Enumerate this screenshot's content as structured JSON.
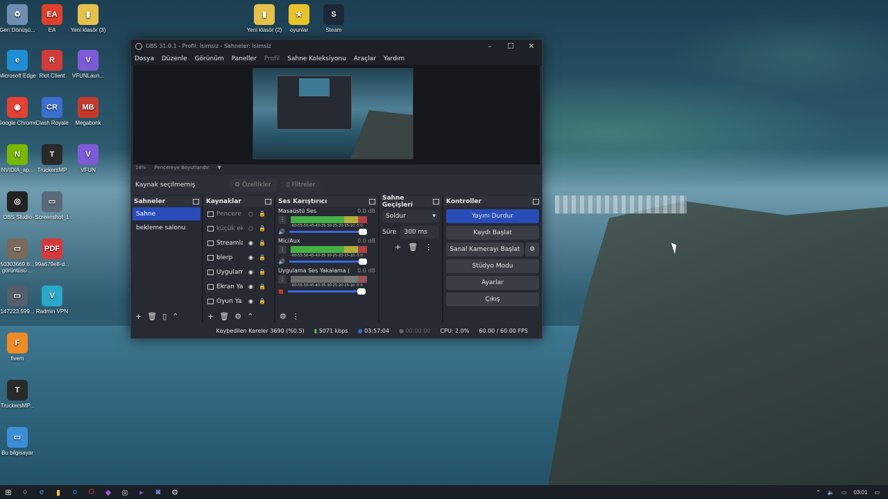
{
  "desktop": {
    "icons": [
      {
        "label": "Geri Dönüşü...",
        "color": "#6f8fb0",
        "glyph": "♻"
      },
      {
        "label": "EA",
        "color": "#e0402a",
        "glyph": "EA"
      },
      {
        "label": "Yeni klasör (3)",
        "color": "#e5c14b",
        "glyph": "▮"
      },
      {
        "label": "Microsoft Edge",
        "color": "#1e8fd6",
        "glyph": "e"
      },
      {
        "label": "Riot Client",
        "color": "#d43b3b",
        "glyph": "R"
      },
      {
        "label": "VFUNLaun...",
        "color": "#7d5bd6",
        "glyph": "V"
      },
      {
        "label": "Google Chrome",
        "color": "#e44134",
        "glyph": "◉"
      },
      {
        "label": "Clash Royale",
        "color": "#3b6fd1",
        "glyph": "CR"
      },
      {
        "label": "Megabonk",
        "color": "#c5392a",
        "glyph": "MB"
      },
      {
        "label": "NVIDIA_ap...",
        "color": "#76b900",
        "glyph": "N"
      },
      {
        "label": "TruckersMP",
        "color": "#2a2a2a",
        "glyph": "T"
      },
      {
        "label": "VFUN",
        "color": "#7d5bd6",
        "glyph": "V"
      },
      {
        "label": "OBS Studio",
        "color": "#222",
        "glyph": "◎"
      },
      {
        "label": "Screenshot_1",
        "color": "#5a6a7a",
        "glyph": "▭"
      },
      {
        "label": "50303669.6... görüntüsü ...",
        "color": "#7a6a5a",
        "glyph": "▭"
      },
      {
        "label": "99a679e8-d...",
        "color": "#d63a3a",
        "glyph": "PDF"
      },
      {
        "label": "147223.599...",
        "color": "#555e6a",
        "glyph": "▭"
      },
      {
        "label": "Radmin VPN",
        "color": "#2aa8c9",
        "glyph": "V"
      },
      {
        "label": "fivem",
        "color": "#f08a24",
        "glyph": "F"
      },
      {
        "label": "TruckersMP...",
        "color": "#2a2a2a",
        "glyph": "T"
      },
      {
        "label": "Bu bilgisayar",
        "color": "#3a8fd6",
        "glyph": "▭"
      },
      {
        "label": "Yeni klasör (2)",
        "color": "#e5c14b",
        "glyph": "▮"
      },
      {
        "label": "oyunlar",
        "color": "#e8c32a",
        "glyph": "★"
      },
      {
        "label": "Steam",
        "color": "#1b2838",
        "glyph": "S"
      }
    ]
  },
  "obs": {
    "title": "OBS 31.0.1 - Profil: İsimsiz - Sahneler: İsimsiz",
    "menu": [
      "Dosya",
      "Düzenle",
      "Görünüm",
      "Paneller",
      "Profil",
      "Sahne Koleksiyonu",
      "Araçlar",
      "Yardım"
    ],
    "zoom": "18%",
    "zoom_mode": "Pencereye Boyutlandır",
    "source_status": "Kaynak seçilmemiş",
    "properties_btn": "Özellikler",
    "filters_btn": "Filtreler",
    "scenes": {
      "title": "Sahneler",
      "items": [
        "Sahne",
        "bekleme salonu"
      ]
    },
    "sources": {
      "title": "Kaynaklar",
      "items": [
        "Pencere",
        "küçük ek",
        "Streamla",
        "blerp",
        "Uygulam",
        "Ekran Ya",
        "Oyun Ya"
      ]
    },
    "mixer": {
      "title": "Ses Karıştırıcı",
      "channels": [
        {
          "name": "Masaüstü Ses",
          "db": "0.0 dB"
        },
        {
          "name": "Mic/Aux",
          "db": "0.0 dB"
        },
        {
          "name": "Uygulama Ses Yakalama (B",
          "db": "0.0 dB"
        }
      ],
      "ticks": "-60-55-50-45-40-35-30-25-20-15-10 -5  0"
    },
    "transitions": {
      "title": "Sahne Geçişleri",
      "type": "Soldur",
      "duration_label": "Süre",
      "duration": "300 ms"
    },
    "controls": {
      "title": "Kontroller",
      "stop_stream": "Yayını Durdur",
      "start_record": "Kaydı Başlat",
      "virtual_cam": "Sanal Kamerayı Başlat",
      "studio_mode": "Stüdyo Modu",
      "settings": "Ayarlar",
      "exit": "Çıkış"
    },
    "status": {
      "dropped": "Kaybedilen Kareler 3690 (%0.5)",
      "bitrate": "5071 kbps",
      "stream_time": "03:57:04",
      "rec_time": "00:00:00",
      "cpu": "CPU: 2.0%",
      "fps": "60.00 / 60.00 FPS"
    }
  },
  "taskbar": {
    "clock": "03:01"
  }
}
